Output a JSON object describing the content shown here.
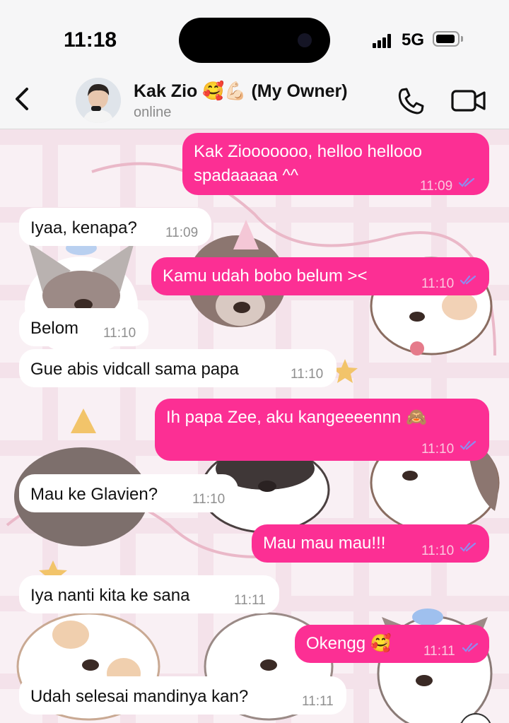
{
  "status_bar": {
    "time": "11:18",
    "network": "5G"
  },
  "header": {
    "contact_name": "Kak Zio",
    "contact_emoji": "🥰💪🏻",
    "contact_suffix": "(My Owner)",
    "status": "online",
    "icons": [
      "back-chevron-icon",
      "phone-icon",
      "video-camera-icon"
    ]
  },
  "theme": {
    "outgoing_bubble": "#fc2f94",
    "incoming_bubble": "#ffffff",
    "read_ticks": "#8e8cf0"
  },
  "messages": [
    {
      "dir": "out",
      "text": "Kak Ziooooooo, helloo hellooo",
      "text2": "spadaaaaa ^^",
      "time": "11:09",
      "read": true
    },
    {
      "dir": "in",
      "text": "Iyaa, kenapa?",
      "time": "11:09"
    },
    {
      "dir": "out",
      "text": "Kamu udah bobo belum ><",
      "time": "11:10",
      "read": true
    },
    {
      "dir": "in",
      "text": "Belom",
      "time": "11:10"
    },
    {
      "dir": "in",
      "text": "Gue abis vidcall sama papa",
      "time": "11:10"
    },
    {
      "dir": "out",
      "text": "Ih papa Zee, aku kangeeeennn 🙈",
      "time": "11:10",
      "read": true
    },
    {
      "dir": "in",
      "text": "Mau ke Glavien?",
      "time": "11:10"
    },
    {
      "dir": "out",
      "text": "Mau mau mau!!!",
      "time": "11:10",
      "read": true
    },
    {
      "dir": "in",
      "text": "Iya nanti kita ke sana",
      "time": "11:11"
    },
    {
      "dir": "out",
      "text": "Okengg 🥰",
      "time": "11:11",
      "read": true
    },
    {
      "dir": "in",
      "text": "Udah selesai mandinya kan?",
      "time": "11:11"
    }
  ]
}
